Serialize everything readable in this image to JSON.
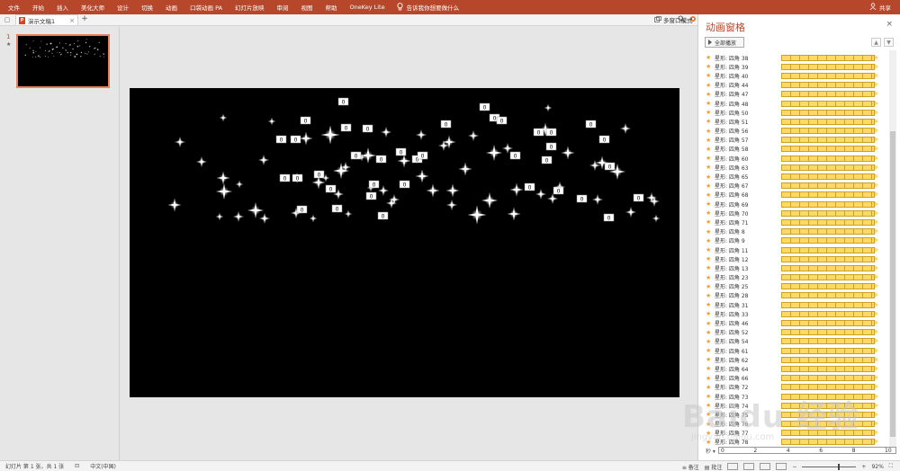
{
  "ribbon": {
    "menus": [
      "文件",
      "开始",
      "插入",
      "美化大师",
      "设计",
      "切换",
      "动画",
      "口袋动画 PA",
      "幻灯片放映",
      "审阅",
      "视图",
      "帮助",
      "OneKey Lite"
    ],
    "tell_me": "告诉我你想要做什么",
    "share": "共享"
  },
  "tabs": {
    "doc_title": "演示文稿1",
    "close": "×",
    "add": "+",
    "multi_window": "多窗口模式"
  },
  "thumbnails": {
    "slide_number": "1",
    "star": "★"
  },
  "anim_pane": {
    "title": "动画窗格",
    "close": "×",
    "play_all": "全部播放",
    "items": [
      "星形: 四角 38",
      "星形: 四角 39",
      "星形: 四角 40",
      "星形: 四角 44",
      "星形: 四角 47",
      "星形: 四角 48",
      "星形: 四角 50",
      "星形: 四角 51",
      "星形: 四角 56",
      "星形: 四角 57",
      "星形: 四角 58",
      "星形: 四角 60",
      "星形: 四角 63",
      "星形: 四角 65",
      "星形: 四角 67",
      "星形: 四角 68",
      "星形: 四角 69",
      "星形: 四角 70",
      "星形: 四角 71",
      "星形: 四角 8",
      "星形: 四角 9",
      "星形: 四角 11",
      "星形: 四角 12",
      "星形: 四角 13",
      "星形: 四角 23",
      "星形: 四角 25",
      "星形: 四角 28",
      "星形: 四角 31",
      "星形: 四角 33",
      "星形: 四角 46",
      "星形: 四角 52",
      "星形: 四角 54",
      "星形: 四角 61",
      "星形: 四角 62",
      "星形: 四角 64",
      "星形: 四角 66",
      "星形: 四角 72",
      "星形: 四角 73",
      "星形: 四角 74",
      "星形: 四角 75",
      "星形: 四角 76",
      "星形: 四角 77",
      "星形: 四角 78"
    ],
    "timeline": {
      "seconds_label": "秒 ▾",
      "ticks": [
        "0",
        "2",
        "4",
        "6",
        "8",
        "10"
      ]
    }
  },
  "status": {
    "slide_info": "幻灯片 第 1 张，共 1 张",
    "language": "中文(中国)",
    "notes": "备注",
    "comments": "批注",
    "zoom": "92%"
  },
  "slide": {
    "tag_text": "0"
  },
  "watermark": {
    "line1": "Baidu 经验",
    "line2": "jingyan.baidu.com"
  },
  "colors": {
    "ribbon": "#b7472a",
    "bar": "#ffd966",
    "star": "#f0a030"
  }
}
